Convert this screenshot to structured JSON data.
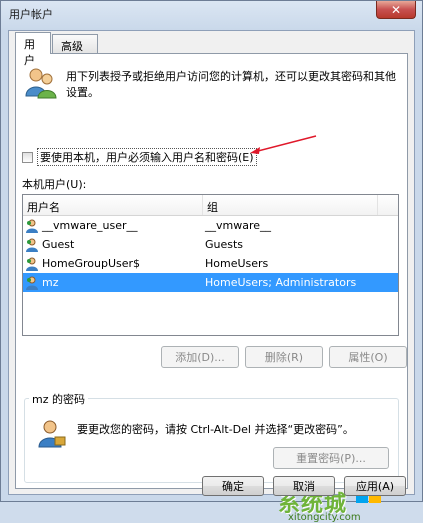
{
  "window": {
    "title": "用户帐户",
    "close_glyph": "✕"
  },
  "tabs": [
    {
      "label": "用户",
      "active": true
    },
    {
      "label": "高级",
      "active": false
    }
  ],
  "intro": {
    "text": "用下列表授予或拒绝用户访问您的计算机，还可以更改其密码和其他设置。"
  },
  "checkbox": {
    "label": "要使用本机，用户必须输入用户名和密码(E)",
    "checked": false
  },
  "local_users": {
    "label": "本机用户(U):",
    "columns": [
      "用户名",
      "组"
    ],
    "rows": [
      {
        "name": "__vmware_user__",
        "group": "__vmware__",
        "selected": false
      },
      {
        "name": "Guest",
        "group": "Guests",
        "selected": false
      },
      {
        "name": "HomeGroupUser$",
        "group": "HomeUsers",
        "selected": false
      },
      {
        "name": "mz",
        "group": "HomeUsers; Administrators",
        "selected": true
      }
    ]
  },
  "list_buttons": {
    "add": "添加(D)...",
    "remove": "删除(R)",
    "properties": "属性(O)"
  },
  "password_group": {
    "title": "mz 的密码",
    "text": "要更改您的密码，请按 Ctrl-Alt-Del 并选择“更改密码”。",
    "reset_button": "重置密码(P)..."
  },
  "dialog_buttons": {
    "ok": "确定",
    "cancel": "取消",
    "apply": "应用(A)"
  },
  "watermark": {
    "text": "系统城",
    "url": "xitongcity.com"
  },
  "colors": {
    "selection": "#3399ff",
    "arrow": "#e0182a",
    "watermark": "#6fb43a"
  }
}
